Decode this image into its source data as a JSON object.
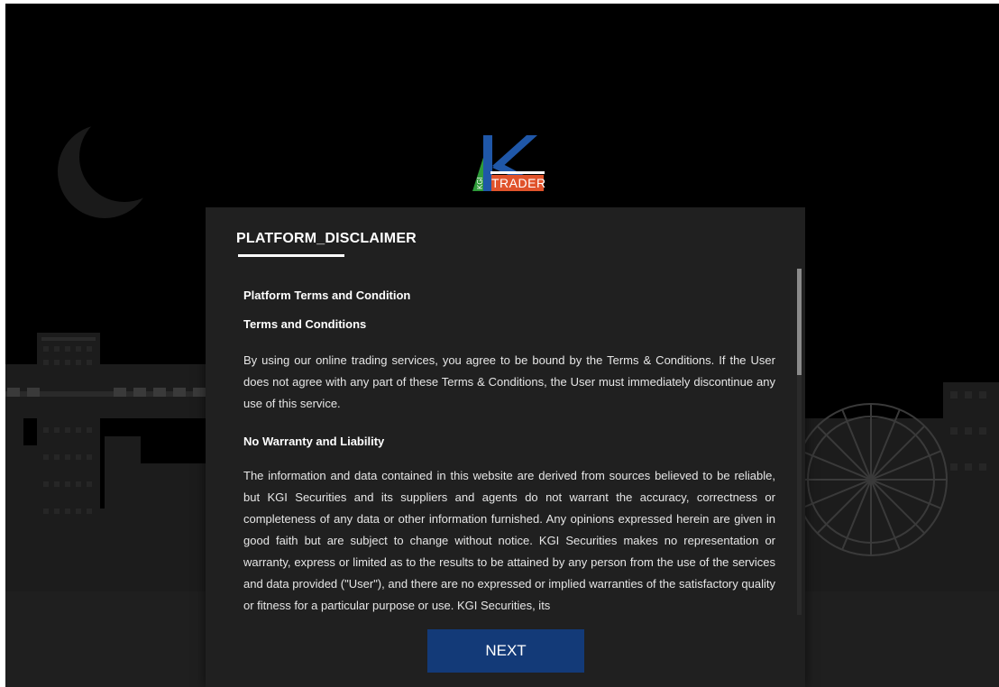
{
  "brand": {
    "logo_letter": "K",
    "logo_tag": "TRADER",
    "logo_side": "KGI"
  },
  "dialog": {
    "title": "PLATFORM_DISCLAIMER",
    "heading_main": "Platform Terms and Condition",
    "heading_terms": "Terms and Conditions",
    "paragraph_terms": "By using our online trading services, you agree to be bound by the Terms & Conditions. If the User does not agree with any part of these Terms & Conditions, the User must immediately discontinue any use of this service.",
    "heading_warranty": "No Warranty and Liability",
    "paragraph_warranty": "The information and data contained in this website are derived from sources believed to be reliable, but KGI Securities and its suppliers and agents do not warrant the accuracy, correctness or completeness of any data or other information furnished. Any opinions expressed herein are given in good faith but are subject to change without notice. KGI Securities makes no representation or warranty, express or limited as to the results to be attained by any person from the use of the services and data provided (\"User\"), and there are no expressed or implied warranties of the satisfactory quality or fitness for a particular purpose or use. KGI Securities, its",
    "next_label": "NEXT"
  },
  "colors": {
    "background": "#000000",
    "dialog": "#202020",
    "button": "#133a78",
    "logo_green": "#2e9b3a",
    "logo_blue": "#1f57a8",
    "logo_orange": "#e0532b"
  },
  "icons": {
    "moon": "moon-icon",
    "ferris_wheel": "ferris-wheel-icon"
  }
}
